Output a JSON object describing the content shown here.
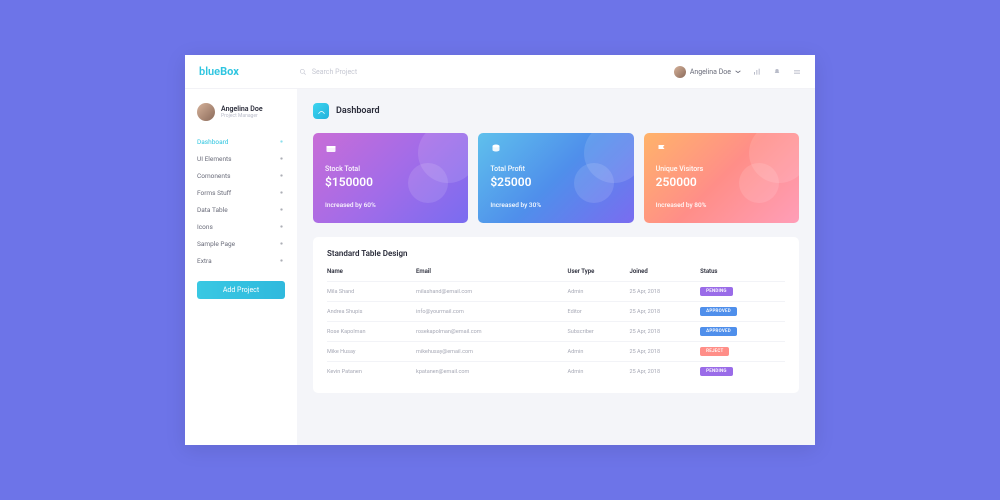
{
  "brand": {
    "part1": "blue",
    "part2": "Box"
  },
  "search": {
    "placeholder": "Search Project"
  },
  "topUser": {
    "name": "Angelina Doe"
  },
  "profile": {
    "name": "Angelina Doe",
    "role": "Project Manager"
  },
  "nav": {
    "items": [
      {
        "label": "Dashboard",
        "active": true
      },
      {
        "label": "UI Elements"
      },
      {
        "label": "Comonents"
      },
      {
        "label": "Forms Stuff"
      },
      {
        "label": "Data Table"
      },
      {
        "label": "Icons"
      },
      {
        "label": "Sample Page"
      },
      {
        "label": "Extra"
      }
    ],
    "add_label": "Add Project"
  },
  "page": {
    "title": "Dashboard"
  },
  "cards": [
    {
      "title": "Stock Total",
      "value": "$150000",
      "sub": "Increased by 60%"
    },
    {
      "title": "Total Profit",
      "value": "$25000",
      "sub": "Increased by 30%"
    },
    {
      "title": "Unique Visitors",
      "value": "250000",
      "sub": "Increased by 80%"
    }
  ],
  "table": {
    "title": "Standard Table Design",
    "headers": [
      "Name",
      "Email",
      "User Type",
      "Joined",
      "Status"
    ],
    "rows": [
      {
        "name": "Mila Shand",
        "email": "milashand@email.com",
        "type": "Admin",
        "joined": "25 Apr, 2018",
        "status": "PENDING",
        "status_class": "pending"
      },
      {
        "name": "Andrea Shupis",
        "email": "info@yourmail.com",
        "type": "Editor",
        "joined": "25 Apr, 2018",
        "status": "APPROVED",
        "status_class": "approved"
      },
      {
        "name": "Rose Kapolman",
        "email": "rosekapolman@email.com",
        "type": "Subscriber",
        "joined": "25 Apr, 2018",
        "status": "APPROVED",
        "status_class": "approved"
      },
      {
        "name": "Mike Husay",
        "email": "mikehusay@email.com",
        "type": "Admin",
        "joined": "25 Apr, 2018",
        "status": "REJECT",
        "status_class": "reject"
      },
      {
        "name": "Kevin Patanen",
        "email": "kpatanen@email.com",
        "type": "Admin",
        "joined": "25 Apr, 2018",
        "status": "PENDING",
        "status_class": "pending"
      }
    ]
  }
}
